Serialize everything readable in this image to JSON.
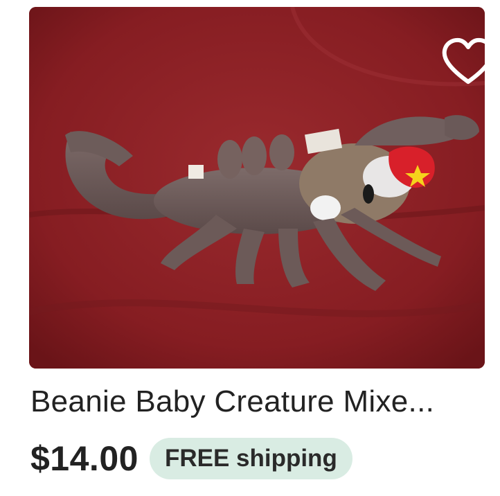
{
  "listing": {
    "title": "Beanie Baby Creature Mixe...",
    "price": "$14.00",
    "shipping_badge": "FREE shipping",
    "image_subject": "brown plush scorpion beanie baby on red fabric",
    "favorite_icon": "heart-outline-icon",
    "favorite_active": false
  },
  "colors": {
    "badge_background": "#d9ece3",
    "text": "#222222",
    "photo_background": "#8a1f24"
  }
}
